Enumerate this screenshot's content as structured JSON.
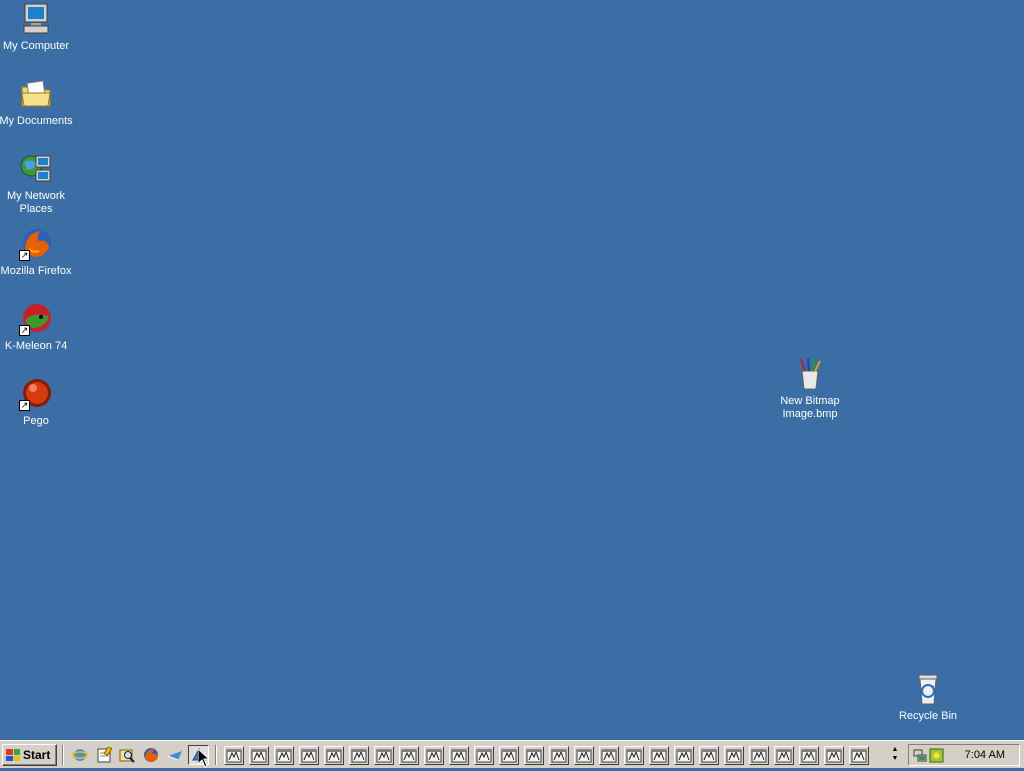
{
  "desktop": {
    "background": "#3a6ea5",
    "icons": [
      {
        "label": "My Computer",
        "icon": "my-computer-icon"
      },
      {
        "label": "My Documents",
        "icon": "my-documents-icon"
      },
      {
        "label": "My Network Places",
        "icon": "network-places-icon"
      },
      {
        "label": "Mozilla Firefox",
        "icon": "firefox-icon"
      },
      {
        "label": "K-Meleon 74",
        "icon": "k-meleon-icon"
      },
      {
        "label": "Pego",
        "icon": "pego-icon"
      },
      {
        "label": "New Bitmap Image.bmp",
        "icon": "bitmap-file-icon"
      },
      {
        "label": "Recycle Bin",
        "icon": "recycle-bin-icon"
      }
    ]
  },
  "taskbar": {
    "start_label": "Start",
    "quick_launch": [
      "ie-icon",
      "notepad-icon",
      "search-icon",
      "firefox-icon",
      "send-icon",
      "k-meleon-icon"
    ],
    "window_button_count": 26,
    "clock": "7:04 AM"
  }
}
